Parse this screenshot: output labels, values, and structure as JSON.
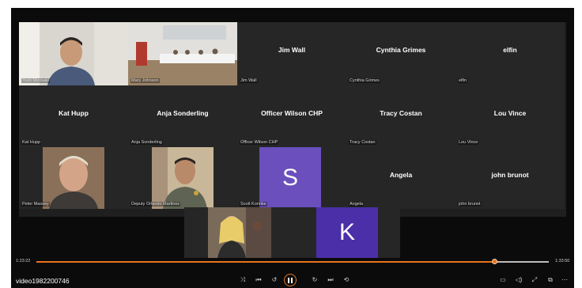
{
  "player": {
    "title": "video1982200746",
    "elapsed": "1:23:22",
    "duration": "1:33:50",
    "progress": 0.895,
    "accent": "#e8741c"
  },
  "participants": [
    {
      "name": "Yosh Morisaki",
      "type": "video"
    },
    {
      "name": "Mary Johnson",
      "type": "video"
    },
    {
      "name": "Jim Wall",
      "type": "name"
    },
    {
      "name": "Cynthia Grimes",
      "type": "name"
    },
    {
      "name": "elfin",
      "type": "name"
    },
    {
      "name": "Kat Hupp",
      "type": "name"
    },
    {
      "name": "Anja Sonderling",
      "type": "name"
    },
    {
      "name": "Officer Wilson CHP",
      "type": "name"
    },
    {
      "name": "Tracy Costan",
      "type": "name"
    },
    {
      "name": "Lou Vince",
      "type": "name"
    },
    {
      "name": "Peter Massey",
      "type": "video"
    },
    {
      "name": "Deputy Orlando Martinez",
      "type": "video"
    },
    {
      "name": "Scott Korinke",
      "type": "avatar",
      "letter": "S",
      "color": "#6a4fbd"
    },
    {
      "name": "Angela",
      "type": "name"
    },
    {
      "name": "john brunot",
      "type": "name"
    }
  ],
  "strip": [
    {
      "type": "video"
    },
    {
      "type": "avatar",
      "letter": "K",
      "color": "#4b2fa8"
    }
  ],
  "controls": {
    "shuffle_icon": "shuffle-icon",
    "prev_icon": "skip-previous-icon",
    "rewind_icon": "rewind-icon",
    "pause_icon": "pause-icon",
    "forward_icon": "fast-forward-icon",
    "next_icon": "skip-next-icon",
    "repeat_icon": "repeat-icon",
    "captions_icon": "captions-icon",
    "volume_icon": "volume-icon",
    "fullscreen_icon": "fullscreen-icon",
    "miniplayer_icon": "miniplayer-icon",
    "more_icon": "more-icon"
  }
}
